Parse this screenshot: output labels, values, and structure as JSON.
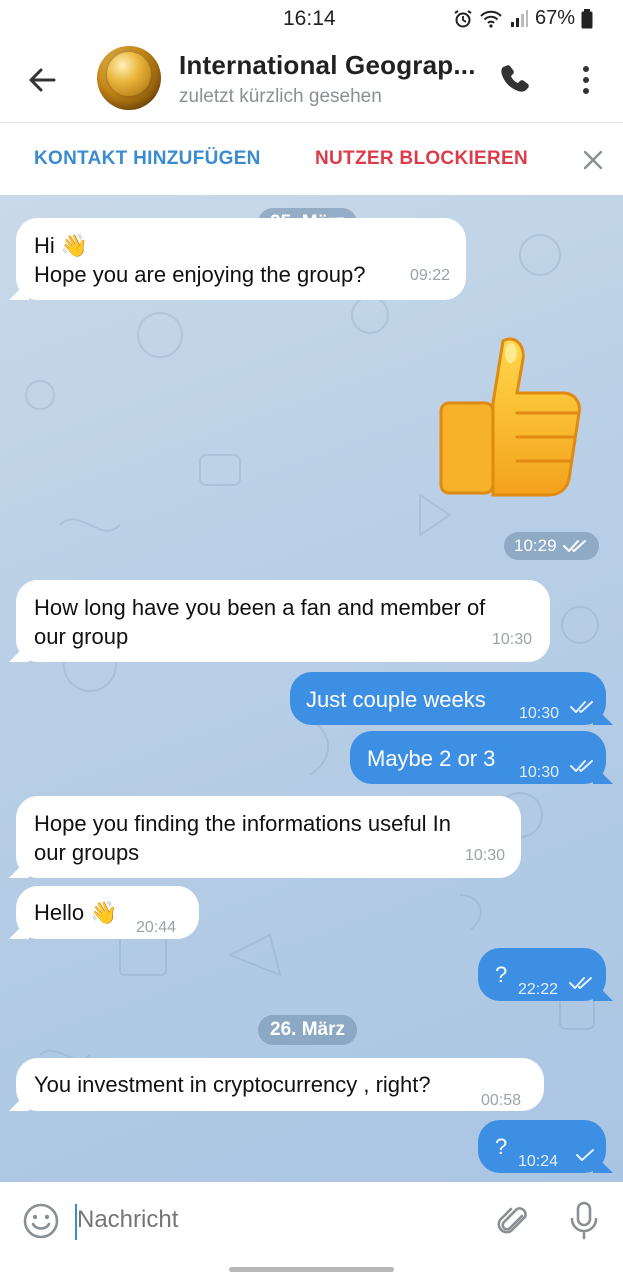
{
  "status_bar": {
    "time": "16:14",
    "battery": "67%"
  },
  "header": {
    "contact_name": "International Geograp...",
    "contact_status": "zuletzt kürzlich gesehen"
  },
  "action_bar": {
    "add_contact": "KONTAKT HINZUFÜGEN",
    "block_user": "NUTZER BLOCKIEREN"
  },
  "dates": [
    "25. März",
    "26. März"
  ],
  "messages": [
    {
      "direction": "in",
      "text": "Hi 👋\nHope you are enjoying the group?",
      "time": "09:22"
    },
    {
      "direction": "out",
      "type": "sticker",
      "sticker": "thumbs-up",
      "time": "10:29",
      "status": "read"
    },
    {
      "direction": "in",
      "text": "How long have you been a fan and member of\nour group",
      "time": "10:30"
    },
    {
      "direction": "out",
      "text": "Just couple weeks",
      "time": "10:30",
      "status": "read"
    },
    {
      "direction": "out",
      "text": "Maybe 2 or 3",
      "time": "10:30",
      "status": "read"
    },
    {
      "direction": "in",
      "text": "Hope you finding the informations useful In\nour groups",
      "time": "10:30"
    },
    {
      "direction": "in",
      "text": "Hello 👋",
      "time": "20:44"
    },
    {
      "direction": "out",
      "text": "?",
      "time": "22:22",
      "status": "read"
    },
    {
      "direction": "in",
      "text": "You investment in cryptocurrency , right?",
      "time": "00:58"
    },
    {
      "direction": "out",
      "text": "?",
      "time": "10:24",
      "status": "sent"
    }
  ],
  "composer": {
    "placeholder": "Nachricht"
  },
  "colors": {
    "accent": "#3a8bd0",
    "danger": "#de3b4a",
    "outgoing_bubble": "#3d8fe4"
  }
}
